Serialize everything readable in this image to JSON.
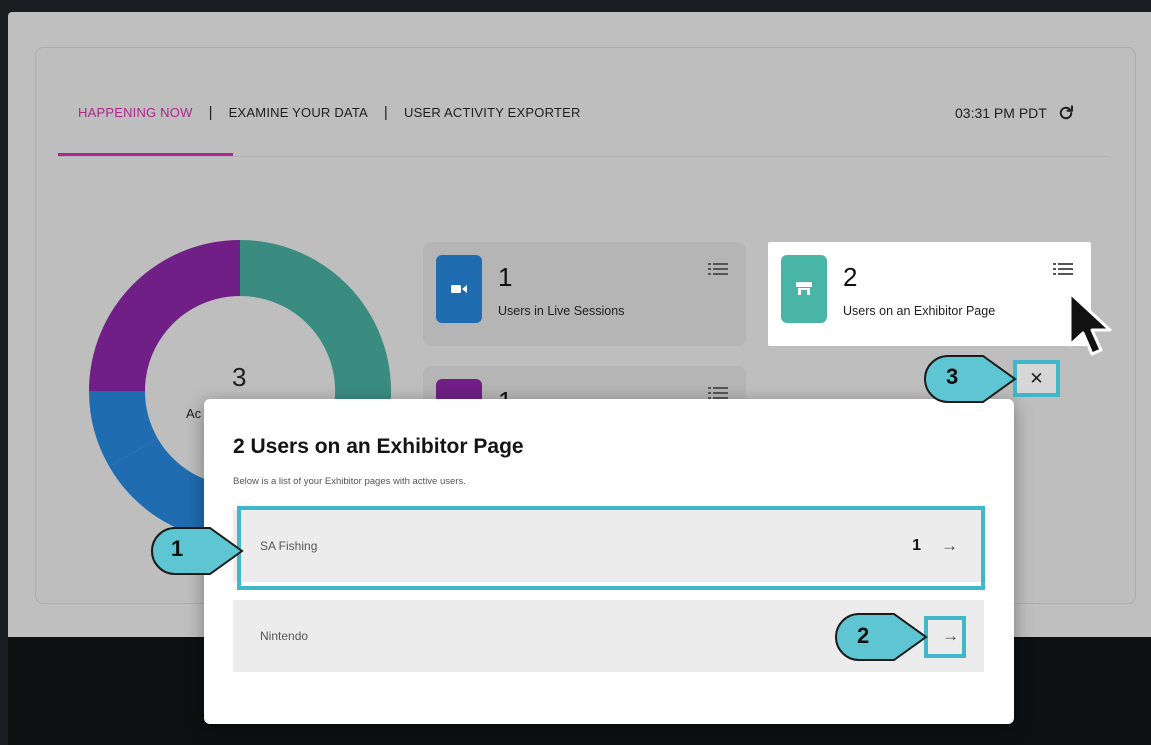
{
  "tabs": [
    {
      "label": "HAPPENING NOW",
      "active": true
    },
    {
      "label": "EXAMINE YOUR DATA",
      "active": false
    },
    {
      "label": "USER ACTIVITY EXPORTER",
      "active": false
    }
  ],
  "separator": "|",
  "clock": {
    "time": "03:31 PM PDT",
    "icon": "refresh-icon"
  },
  "donut": {
    "count": "3",
    "label": "Ac",
    "segments": [
      {
        "color": "#3a8c80",
        "fraction": 0.333
      },
      {
        "color": "#1f6cb0",
        "fraction": 0.333
      },
      {
        "color": "#6f1f85",
        "fraction": 0.333
      }
    ]
  },
  "cards": {
    "live": {
      "count": "1",
      "label": "Users in Live Sessions",
      "icon": "video-camera-icon",
      "color": "#1f6cb0"
    },
    "exhibitor": {
      "count": "2",
      "label": "Users on an Exhibitor Page",
      "icon": "storefront-icon",
      "color": "#49b5a6"
    },
    "third": {
      "count": "1",
      "icon": "people-icon",
      "color": "#6f1f85"
    }
  },
  "modal": {
    "title": "2 Users on an Exhibitor Page",
    "subtitle": "Below is a list of your Exhibitor pages with active users.",
    "rows": [
      {
        "name": "SA Fishing",
        "count": "1",
        "arrow": "→"
      },
      {
        "name": "Nintendo",
        "count": "",
        "arrow": "→"
      }
    ],
    "close": "✕"
  },
  "callouts": [
    "1",
    "2",
    "3"
  ],
  "colors": {
    "accent": "#b0268c",
    "highlight": "#41b8c9",
    "callout_fill": "#5ec6d3"
  }
}
